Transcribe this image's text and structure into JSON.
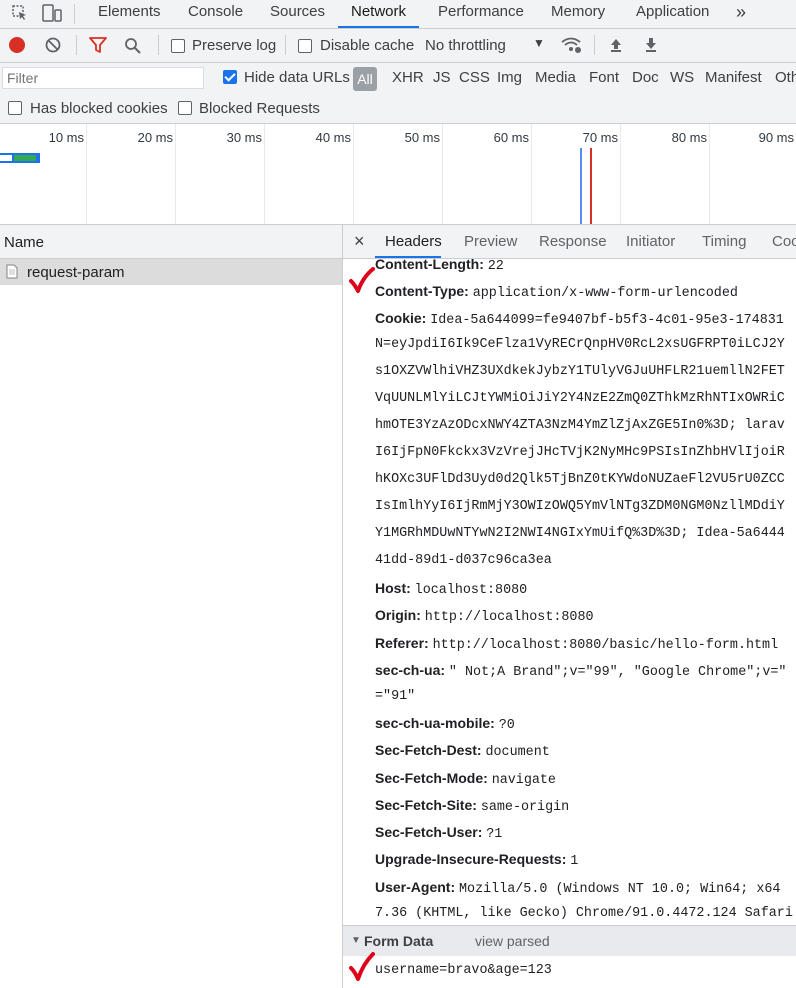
{
  "tabs": {
    "items": [
      "Elements",
      "Console",
      "Sources",
      "Network",
      "Performance",
      "Memory",
      "Application"
    ],
    "overflow": "»"
  },
  "toolbar": {
    "preserve_log": "Preserve log",
    "disable_cache": "Disable cache",
    "throttling": "No throttling",
    "record_color": "#d93025",
    "filter_color": "#d93025"
  },
  "filter": {
    "placeholder": "Filter",
    "hide_data_urls": "Hide data URLs",
    "all": "All",
    "types": [
      "XHR",
      "JS",
      "CSS",
      "Img",
      "Media",
      "Font",
      "Doc",
      "WS",
      "Manifest",
      "Oth"
    ]
  },
  "blocked": {
    "has_blocked_cookies": "Has blocked cookies",
    "blocked_requests": "Blocked Requests"
  },
  "timeline": {
    "ticks": [
      "10 ms",
      "20 ms",
      "30 ms",
      "40 ms",
      "50 ms",
      "60 ms",
      "70 ms",
      "80 ms",
      "90 ms"
    ]
  },
  "requests": {
    "header": "Name",
    "items": [
      {
        "name": "request-param"
      }
    ]
  },
  "details": {
    "close": "×",
    "tabs": [
      "Headers",
      "Preview",
      "Response",
      "Initiator",
      "Timing",
      "Coo"
    ],
    "headers": [
      {
        "name": "Content-Length:",
        "value": "22"
      },
      {
        "name": "Content-Type:",
        "value": "application/x-www-form-urlencoded"
      },
      {
        "name": "Cookie:",
        "value": "Idea-5a644099=fe9407bf-b5f3-4c01-95e3-174831"
      },
      {
        "name": "Host:",
        "value": "localhost:8080"
      },
      {
        "name": "Origin:",
        "value": "http://localhost:8080"
      },
      {
        "name": "Referer:",
        "value": "http://localhost:8080/basic/hello-form.html"
      },
      {
        "name": "sec-ch-ua:",
        "value": "\" Not;A Brand\";v=\"99\", \"Google Chrome\";v=\""
      },
      {
        "name": "sec-ch-ua-mobile:",
        "value": "?0"
      },
      {
        "name": "Sec-Fetch-Dest:",
        "value": "document"
      },
      {
        "name": "Sec-Fetch-Mode:",
        "value": "navigate"
      },
      {
        "name": "Sec-Fetch-Site:",
        "value": "same-origin"
      },
      {
        "name": "Sec-Fetch-User:",
        "value": "?1"
      },
      {
        "name": "Upgrade-Insecure-Requests:",
        "value": "1"
      },
      {
        "name": "User-Agent:",
        "value": "Mozilla/5.0 (Windows NT 10.0; Win64; x64"
      }
    ],
    "cookie_continuation": [
      "N=eyJpdiI6Ik9CeFlza1VyRECrQnpHV0RcL2xsUGFRPT0iLCJ2Y",
      "s1OXZVWlhiVHZ3UXdkekJybzY1TUlyVGJuUHFLR21uemllN2FET",
      "VqUUNLMlYiLCJtYWMiOiJiY2Y4NzE2ZmQ0ZThkMzRhNTIxOWRiC",
      "hmOTE3YzAzODcxNWY4ZTA3NzM4YmZlZjAxZGE5In0%3D; larav",
      "I6IjFpN0Fkckx3VzVrejJHcTVjK2NyMHc9PSIsInZhbHVlIjoiR",
      "hKOXc3UFlDd3Uyd0d2Qlk5TjBnZ0tKYWdoNUZaeFl2VU5rU0ZCC",
      "IsImlhYyI6IjRmMjY3OWIzOWQ5YmVlNTg3ZDM0NGM0NzllMDdiY",
      "Y1MGRhMDUwNTYwN2I2NWI4NGIxYmUifQ%3D%3D; Idea-5a6444",
      "41dd-89d1-d037c96ca3ea"
    ],
    "sec_ch_ua_continuation": "=\"91\"",
    "user_agent_continuation": "7.36 (KHTML, like Gecko) Chrome/91.0.4472.124 Safari",
    "form_data": {
      "title": "Form Data",
      "view_parsed": "view parsed",
      "payload": "username=bravo&age=123"
    }
  }
}
